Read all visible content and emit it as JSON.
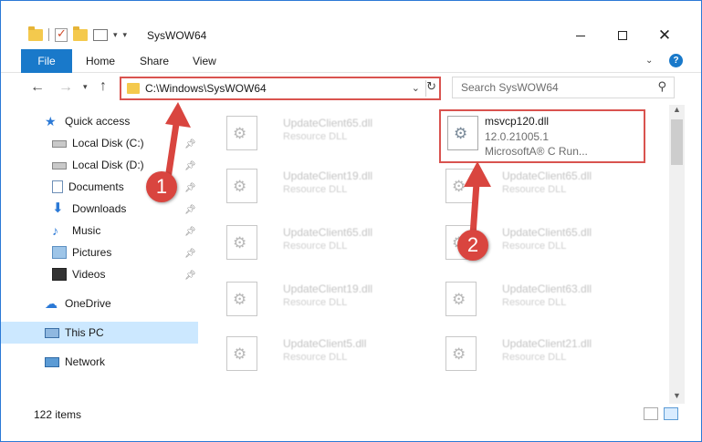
{
  "window": {
    "title": "SysWOW64",
    "controls": {
      "minimize": "",
      "maximize": "",
      "close": "✕"
    }
  },
  "ribbon": {
    "tabs": {
      "file": "File",
      "home": "Home",
      "share": "Share",
      "view": "View"
    },
    "help": "?"
  },
  "navigation": {
    "address": "C:\\Windows\\SysWOW64",
    "search_placeholder": "Search SysWOW64"
  },
  "sidebar": {
    "quick_access": "Quick access",
    "items": [
      {
        "label": "Local Disk (C:)",
        "icon": "disk-icon",
        "pinned": true
      },
      {
        "label": "Local Disk (D:)",
        "icon": "disk-icon",
        "pinned": true
      },
      {
        "label": "Documents",
        "icon": "documents-icon",
        "pinned": true
      },
      {
        "label": "Downloads",
        "icon": "downloads-icon",
        "pinned": true
      },
      {
        "label": "Music",
        "icon": "music-icon",
        "pinned": true
      },
      {
        "label": "Pictures",
        "icon": "pictures-icon",
        "pinned": true
      },
      {
        "label": "Videos",
        "icon": "videos-icon",
        "pinned": true
      }
    ],
    "onedrive": "OneDrive",
    "this_pc": "This PC",
    "network": "Network"
  },
  "files": {
    "highlighted": {
      "name": "msvcp120.dll",
      "version": "12.0.21005.1",
      "description": "MicrosoftA® C Run..."
    },
    "blurred": [
      {
        "name": "UpdateClient65.dll",
        "type": "Resource DLL"
      },
      {
        "name": "UpdateClient19.dll",
        "type": "Resource DLL"
      },
      {
        "name": "UpdateClient65.dll",
        "type": "Resource DLL"
      },
      {
        "name": "UpdateClient65.dll",
        "type": "Resource DLL"
      },
      {
        "name": "UpdateClient65.dll",
        "type": "Resource DLL"
      },
      {
        "name": "UpdateClient19.dll",
        "type": "Resource DLL"
      },
      {
        "name": "UpdateClient63.dll",
        "type": "Resource DLL"
      },
      {
        "name": "UpdateClient5.dll",
        "type": "Resource DLL"
      },
      {
        "name": "UpdateClient21.dll",
        "type": "Resource DLL"
      }
    ]
  },
  "status": {
    "item_count": "122 items"
  },
  "annotations": {
    "step1": "1",
    "step2": "2"
  },
  "colors": {
    "accent": "#1979ca",
    "annotation": "#d9453f",
    "selection": "#cce8ff"
  }
}
